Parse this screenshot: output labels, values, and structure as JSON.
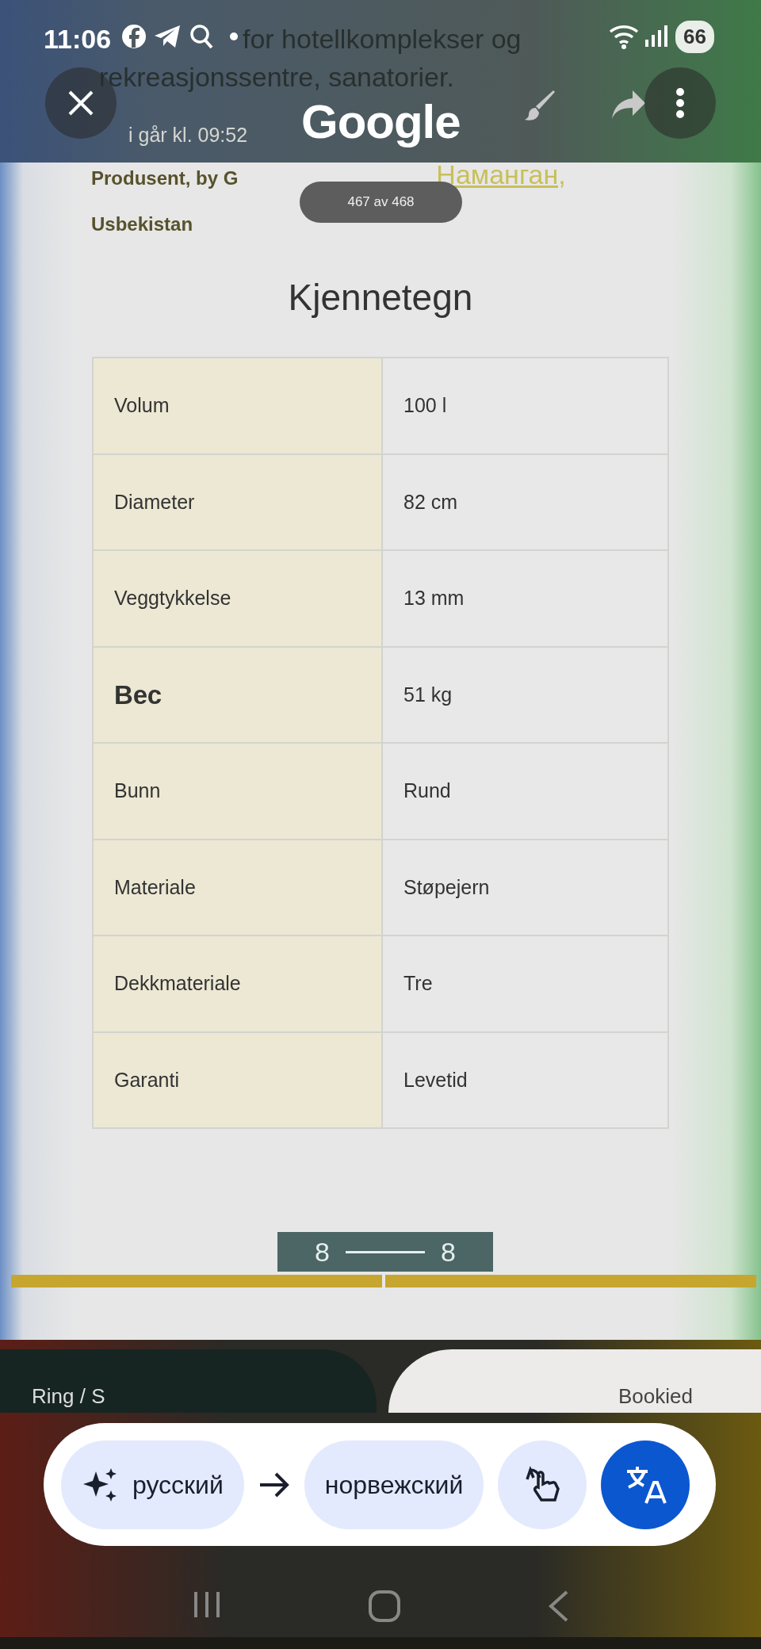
{
  "status_bar": {
    "time": "11:06",
    "battery": "66"
  },
  "document": {
    "top_lines": [
      "for hotellkomplekser og",
      "rekreasjonssentre, sanatorier."
    ],
    "timestamp": "i går kl. 09:52",
    "producer": "Produsent, by G",
    "place": "Наманган,",
    "country": "Usbekistan"
  },
  "toolbar": {
    "logo": "Google"
  },
  "page_counter": "467 av 468",
  "heading": "Kjennetegn",
  "table": {
    "rows": [
      {
        "label": "Volum",
        "value": "100 l",
        "bold": false
      },
      {
        "label": "Diameter",
        "value": "82 cm",
        "bold": false
      },
      {
        "label": "Veggtykkelse",
        "value": "13 mm",
        "bold": false
      },
      {
        "label": "Вес",
        "value": "51 kg",
        "bold": true
      },
      {
        "label": "Bunn",
        "value": "Rund",
        "bold": false
      },
      {
        "label": "Materiale",
        "value": "Støpejern",
        "bold": false
      },
      {
        "label": "Dekkmateriale",
        "value": "Tre",
        "bold": false
      },
      {
        "label": "Garanti",
        "value": "Levetid",
        "bold": false
      }
    ]
  },
  "range_box": {
    "from": "8",
    "to": "8"
  },
  "cards": [
    {
      "label": "Ring / S",
      "kind": "dark"
    },
    {
      "label": "Bookied",
      "kind": "light"
    }
  ],
  "translate_bar": {
    "source_language": "русский",
    "target_language": "норвежский",
    "modes": [
      {
        "kind": "tap",
        "selected": false
      },
      {
        "kind": "translate",
        "selected": true
      }
    ]
  }
}
